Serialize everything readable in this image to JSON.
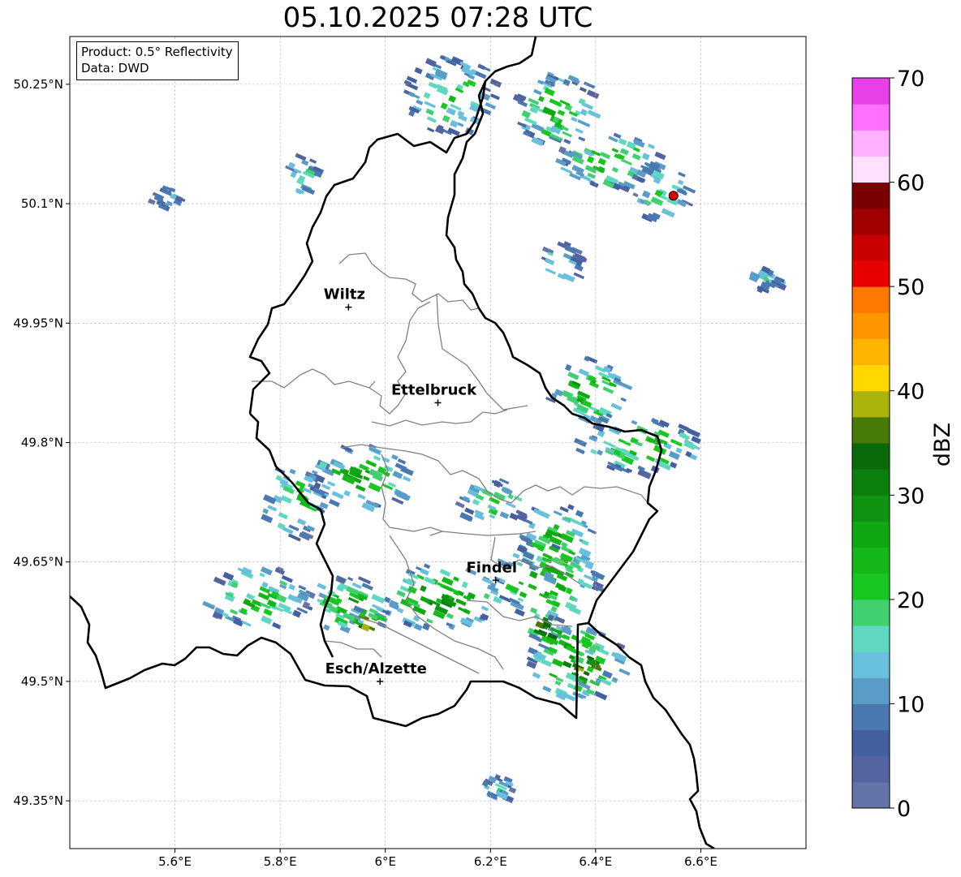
{
  "title": "05.10.2025 07:28 UTC",
  "info": {
    "product": "Product: 0.5° Reflectivity",
    "data": "Data: DWD"
  },
  "map_extent": {
    "lon": [
      5.4,
      6.8
    ],
    "lat": [
      49.29,
      50.31
    ]
  },
  "lat_ticks": [
    {
      "value": 50.25,
      "label": "50.25°N"
    },
    {
      "value": 50.1,
      "label": "50.1°N"
    },
    {
      "value": 49.95,
      "label": "49.95°N"
    },
    {
      "value": 49.8,
      "label": "49.8°N"
    },
    {
      "value": 49.65,
      "label": "49.65°N"
    },
    {
      "value": 49.5,
      "label": "49.5°N"
    },
    {
      "value": 49.35,
      "label": "49.35°N"
    }
  ],
  "lon_ticks": [
    {
      "value": 5.6,
      "label": "5.6°E"
    },
    {
      "value": 5.8,
      "label": "5.8°E"
    },
    {
      "value": 6.0,
      "label": "6°E"
    },
    {
      "value": 6.2,
      "label": "6.2°E"
    },
    {
      "value": 6.4,
      "label": "6.4°E"
    },
    {
      "value": 6.6,
      "label": "6.6°E"
    }
  ],
  "cities": [
    {
      "name": "Wiltz",
      "lon": 5.93,
      "lat": 49.97
    },
    {
      "name": "Ettelbruck",
      "lon": 6.1,
      "lat": 49.85
    },
    {
      "name": "Findel",
      "lon": 6.21,
      "lat": 49.627
    },
    {
      "name": "Esch/Alzette",
      "lon": 5.99,
      "lat": 49.5
    }
  ],
  "radar_site": {
    "lon": 6.548,
    "lat": 50.11,
    "color": "#e00000"
  },
  "colorbar": {
    "label": "dBZ",
    "min": 0,
    "max": 70,
    "tick_values": [
      "0",
      "10",
      "20",
      "30",
      "40",
      "50",
      "60",
      "70"
    ],
    "colors": [
      "#6474a8",
      "#5464a0",
      "#4460a0",
      "#4a78b0",
      "#5a9cc8",
      "#68c0dc",
      "#60d8c0",
      "#40d070",
      "#18c820",
      "#14b818",
      "#10a810",
      "#0e9410",
      "#0c800c",
      "#0a6a0a",
      "#487a0a",
      "#aab40a",
      "#ffd800",
      "#ffb400",
      "#ff9600",
      "#ff7800",
      "#e80000",
      "#c80000",
      "#a00000",
      "#780000",
      "#ffe0ff",
      "#ffb0ff",
      "#ff70ff",
      "#e840e8"
    ]
  },
  "colors": {
    "grid": "#b4b4b4",
    "country_border": "#000000",
    "canton_border": "#808080"
  },
  "echoes": [
    {
      "lon": 6.36,
      "lat": 49.53,
      "dbz": 28,
      "rx": 0.09,
      "ry": 0.05
    },
    {
      "lon": 6.38,
      "lat": 49.52,
      "dbz": 40,
      "rx": 0.04,
      "ry": 0.022
    },
    {
      "lon": 6.3,
      "lat": 49.57,
      "dbz": 38,
      "rx": 0.03,
      "ry": 0.02
    },
    {
      "lon": 6.3,
      "lat": 49.63,
      "dbz": 26,
      "rx": 0.1,
      "ry": 0.05
    },
    {
      "lon": 6.32,
      "lat": 49.68,
      "dbz": 24,
      "rx": 0.07,
      "ry": 0.05
    },
    {
      "lon": 6.1,
      "lat": 49.61,
      "dbz": 27,
      "rx": 0.12,
      "ry": 0.04
    },
    {
      "lon": 5.96,
      "lat": 49.58,
      "dbz": 38,
      "rx": 0.03,
      "ry": 0.02
    },
    {
      "lon": 5.92,
      "lat": 49.6,
      "dbz": 24,
      "rx": 0.08,
      "ry": 0.035
    },
    {
      "lon": 5.75,
      "lat": 49.61,
      "dbz": 22,
      "rx": 0.1,
      "ry": 0.04
    },
    {
      "lon": 5.95,
      "lat": 49.76,
      "dbz": 24,
      "rx": 0.1,
      "ry": 0.04
    },
    {
      "lon": 5.82,
      "lat": 49.73,
      "dbz": 22,
      "rx": 0.06,
      "ry": 0.045
    },
    {
      "lon": 6.2,
      "lat": 49.73,
      "dbz": 20,
      "rx": 0.07,
      "ry": 0.03
    },
    {
      "lon": 6.38,
      "lat": 49.87,
      "dbz": 26,
      "rx": 0.08,
      "ry": 0.04
    },
    {
      "lon": 6.48,
      "lat": 49.8,
      "dbz": 22,
      "rx": 0.12,
      "ry": 0.035
    },
    {
      "lon": 6.42,
      "lat": 50.16,
      "dbz": 22,
      "rx": 0.1,
      "ry": 0.04
    },
    {
      "lon": 6.52,
      "lat": 50.12,
      "dbz": 20,
      "rx": 0.05,
      "ry": 0.04
    },
    {
      "lon": 6.32,
      "lat": 50.22,
      "dbz": 22,
      "rx": 0.08,
      "ry": 0.05
    },
    {
      "lon": 6.12,
      "lat": 50.24,
      "dbz": 20,
      "rx": 0.09,
      "ry": 0.05
    },
    {
      "lon": 5.84,
      "lat": 50.14,
      "dbz": 18,
      "rx": 0.03,
      "ry": 0.03
    },
    {
      "lon": 6.33,
      "lat": 50.03,
      "dbz": 16,
      "rx": 0.04,
      "ry": 0.025
    },
    {
      "lon": 5.58,
      "lat": 50.11,
      "dbz": 12,
      "rx": 0.03,
      "ry": 0.015
    },
    {
      "lon": 6.72,
      "lat": 50.01,
      "dbz": 16,
      "rx": 0.03,
      "ry": 0.015
    },
    {
      "lon": 6.21,
      "lat": 49.37,
      "dbz": 16,
      "rx": 0.03,
      "ry": 0.015
    }
  ]
}
